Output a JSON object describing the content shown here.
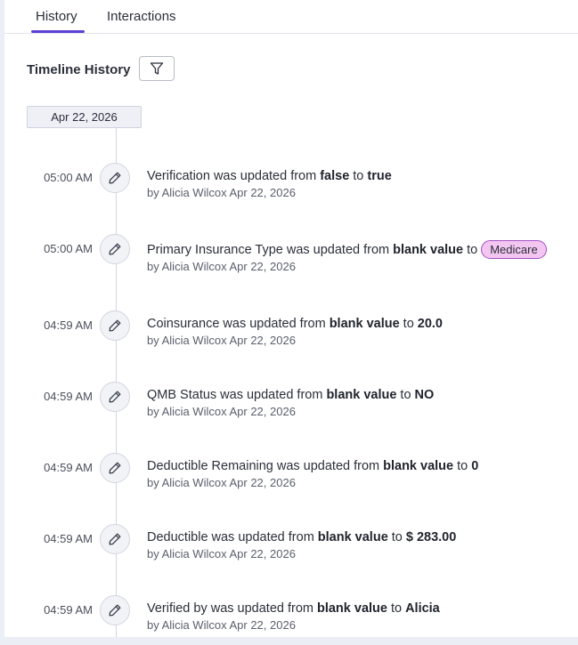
{
  "tabs": {
    "history": "History",
    "interactions": "Interactions",
    "active": "History"
  },
  "timeline": {
    "title": "Timeline History",
    "date": "Apr 22, 2026",
    "entries": [
      {
        "time": "05:00 AM",
        "field": "Verification",
        "mid": "was updated from",
        "from": "false",
        "to_word": "to",
        "to": "true",
        "by": "by Alicia Wilcox Apr 22, 2026"
      },
      {
        "time": "05:00 AM",
        "field": "Primary Insurance Type",
        "mid": "was updated from",
        "from": "blank value",
        "to_word": "to",
        "to": "Medicare",
        "by": "by Alicia Wilcox Apr 22, 2026"
      },
      {
        "time": "04:59 AM",
        "field": "Coinsurance",
        "mid": "was updated from",
        "from": "blank value",
        "to_word": "to",
        "to": "20.0",
        "by": "by Alicia Wilcox Apr 22, 2026"
      },
      {
        "time": "04:59 AM",
        "field": "QMB Status",
        "mid": "was updated from",
        "from": "blank value",
        "to_word": "to",
        "to": "NO",
        "by": "by Alicia Wilcox Apr 22, 2026"
      },
      {
        "time": "04:59 AM",
        "field": "Deductible Remaining",
        "mid": "was updated from",
        "from": "blank value",
        "to_word": "to",
        "to": "0",
        "by": "by Alicia Wilcox Apr 22, 2026"
      },
      {
        "time": "04:59 AM",
        "field": "Deductible",
        "mid": "was updated from",
        "from": "blank value",
        "to_word": "to",
        "to": "$ 283.00",
        "by": "by Alicia Wilcox Apr 22, 2026"
      },
      {
        "time": "04:59 AM",
        "field": "Verified by",
        "mid": "was updated from",
        "from": "blank value",
        "to_word": "to",
        "to": "Alicia",
        "by": "by Alicia Wilcox Apr 22, 2026"
      }
    ]
  },
  "icons": {
    "filter": "filter-icon",
    "edit": "pencil-icon"
  },
  "colors": {
    "accent": "#5b3fd6",
    "pill_bg": "#f3c6f1",
    "pill_border": "#a34fc4"
  }
}
